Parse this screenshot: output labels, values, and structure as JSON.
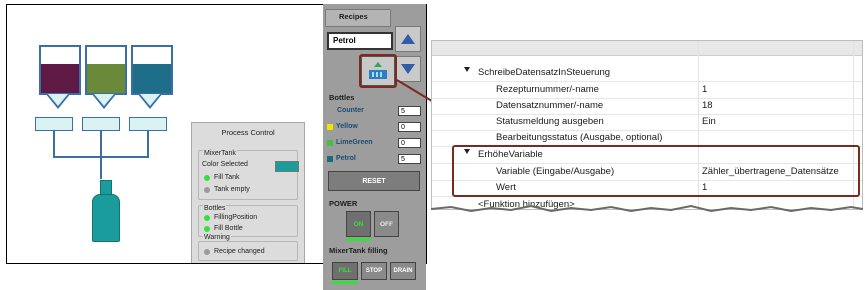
{
  "recipes": {
    "title": "Recipes",
    "value": "Petrol"
  },
  "bottles": {
    "title": "Bottles",
    "rows": [
      {
        "label": "Counter",
        "value": "5",
        "color": ""
      },
      {
        "label": "Yellow",
        "value": "0",
        "color": "#f2e600"
      },
      {
        "label": "LimeGreen",
        "value": "0",
        "color": "#3ec43e"
      },
      {
        "label": "Petrol",
        "value": "5",
        "color": "#1a6b7a"
      }
    ],
    "reset_label": "RESET"
  },
  "power": {
    "title": "POWER",
    "on_label": "ON",
    "off_label": "OFF"
  },
  "mixer_filling": {
    "title": "MixerTank filling",
    "fill_label": "FILL",
    "stop_label": "STOP",
    "drain_label": "DRAIN"
  },
  "process_control": {
    "title": "Process Control",
    "mixer": {
      "title": "MixerTank",
      "color_selected": "Color Selected",
      "fill_tank": "Fill Tank",
      "tank_empty": "Tank empty"
    },
    "bottles": {
      "title": "Bottles",
      "filling_position": "FillingPosition",
      "fill_bottle": "Fill Bottle"
    },
    "warning": {
      "title": "Warning",
      "recipe_changed": "Recipe changed"
    }
  },
  "tanks": [
    {
      "color": "#5e1a45"
    },
    {
      "color": "#6a8a3a"
    },
    {
      "color": "#1e6e8a"
    }
  ],
  "properties": {
    "group1": {
      "title": "SchreibeDatensatzInSteuerung",
      "rows": [
        {
          "name": "Rezepturnummer/-name",
          "value": "1"
        },
        {
          "name": "Datensatznummer/-name",
          "value": "18"
        },
        {
          "name": "Statusmeldung ausgeben",
          "value": "Ein"
        },
        {
          "name": "Bearbeitungsstatus (Ausgabe, optional)",
          "value": ""
        }
      ]
    },
    "group2": {
      "title": "ErhöheVariable",
      "rows": [
        {
          "name": "Variable (Eingabe/Ausgabe)",
          "value": "Zähler_übertragene_Datensätze"
        },
        {
          "name": "Wert",
          "value": "1"
        }
      ]
    },
    "add_function": "<Funktion hinzufügen>"
  },
  "colors": {
    "accent_line": "#8b3a2a",
    "panel_gray": "#9d9d9d",
    "pipe_blue": "#3a6ea5",
    "active_green": "#35e03a"
  }
}
